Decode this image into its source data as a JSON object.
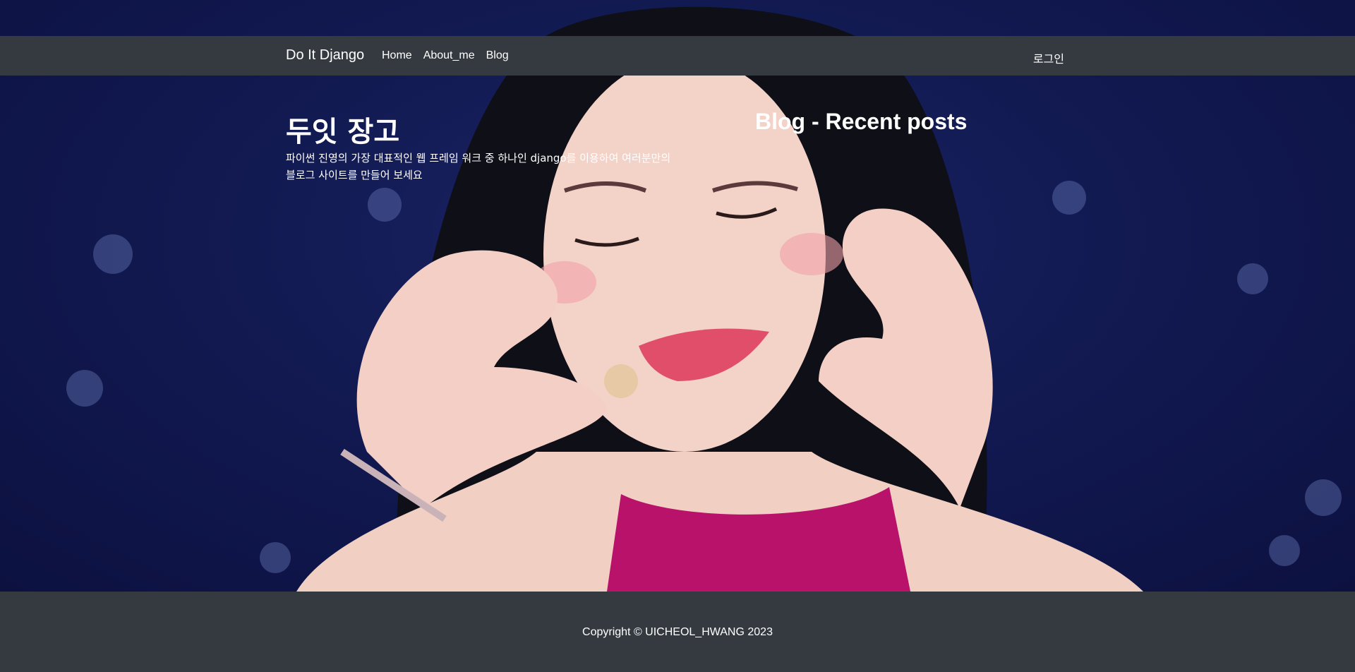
{
  "navbar": {
    "brand": "Do It Django",
    "links": [
      "Home",
      "About_me",
      "Blog"
    ],
    "login": "로그인"
  },
  "hero": {
    "title": "두잇 장고",
    "description": "파이썬 진영의 가장 대표적인 웹 프레임 워크 중 하나인 django를 이용하여 여러분만의 블로그 사이트를 만들어 보세요",
    "recent_title": "Blog - Recent posts"
  },
  "footer": {
    "copyright": "Copyright © UICHEOL_HWANG 2023"
  },
  "colors": {
    "navbar_bg": "#343a40",
    "footer_bg": "#343a40",
    "text": "#ffffff",
    "hero_bg": "#121a52"
  }
}
